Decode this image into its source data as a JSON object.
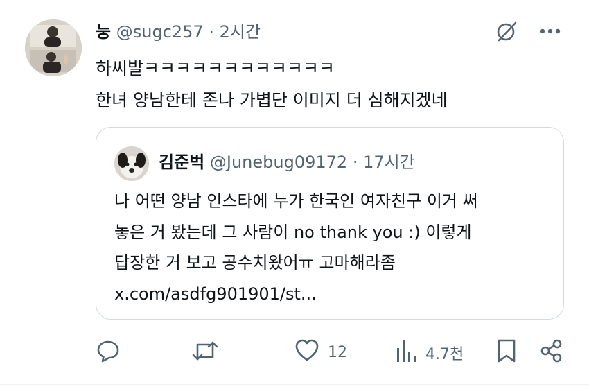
{
  "tweet": {
    "author_name": "눙",
    "author_handle": "@sugc257",
    "separator": "·",
    "time": "2시간",
    "lines": [
      "하씨발ㅋㅋㅋㅋㅋㅋㅋㅋㅋㅋㅋㅋ",
      "한녀 양남한테 존나 가볍단 이미지 더 심해지겠네"
    ]
  },
  "quote": {
    "author_name": "김준벅",
    "author_handle": "@Junebug09172",
    "separator": "·",
    "time": "17시간",
    "lines": [
      "나 어떤 양남 인스타에 누가 한국인 여자친구 이거 써",
      "놓은 거 봤는데 그 사람이 no thank you :) 이렇게",
      "답장한 거 보고 공수치왔어ㅠ 고마해라좀",
      "x.com/asdfg901901/st..."
    ]
  },
  "actions": {
    "likes": "12",
    "views": "4.7천"
  },
  "icons": {
    "top_right": [
      "grok-icon",
      "more-icon"
    ],
    "bottom": [
      "reply-icon",
      "retweet-icon",
      "like-icon",
      "views-icon",
      "bookmark-icon",
      "share-icon"
    ]
  },
  "colors": {
    "text": "#0f1419",
    "secondary": "#536471",
    "border": "#cfd9de"
  }
}
